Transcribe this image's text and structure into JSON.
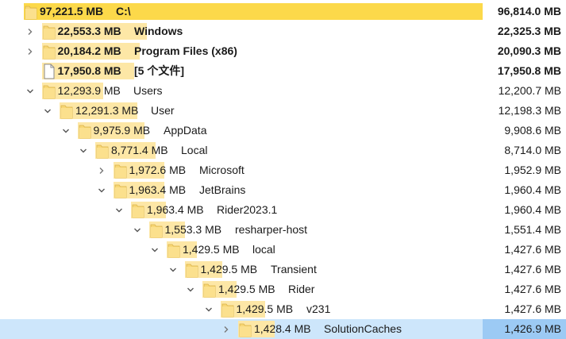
{
  "rows": [
    {
      "size": "97,221.5 MB",
      "name": "C:\\",
      "total": "96,814.0 MB",
      "expanded": null,
      "icon": "folder-icon",
      "bold": true,
      "fraction": 1.0
    },
    {
      "size": "22,553.3 MB",
      "name": "Windows",
      "total": "22,325.3 MB",
      "expanded": false,
      "icon": "folder-icon",
      "bold": true,
      "fraction": 0.232
    },
    {
      "size": "20,184.2 MB",
      "name": "Program Files (x86)",
      "total": "20,090.3 MB",
      "expanded": false,
      "icon": "folder-icon",
      "bold": true,
      "fraction": 0.208
    },
    {
      "size": "17,950.8 MB",
      "name": "[5 个文件]",
      "total": "17,950.8 MB",
      "expanded": null,
      "icon": "file-icon",
      "bold": true,
      "fraction": 0.185
    },
    {
      "size": "12,293.9 MB",
      "name": "Users",
      "total": "12,200.7 MB",
      "expanded": true,
      "icon": "folder-icon",
      "bold": false,
      "fraction": 0.127
    },
    {
      "size": "12,291.3 MB",
      "name": "User",
      "total": "12,198.3 MB",
      "expanded": true,
      "icon": "folder-icon",
      "bold": false,
      "fraction": 0.999
    },
    {
      "size": "9,975.9 MB",
      "name": "AppData",
      "total": "9,908.6 MB",
      "expanded": true,
      "icon": "folder-icon",
      "bold": false,
      "fraction": 0.812
    },
    {
      "size": "8,771.4 MB",
      "name": "Local",
      "total": "8,714.0 MB",
      "expanded": true,
      "icon": "folder-icon",
      "bold": false,
      "fraction": 0.879
    },
    {
      "size": "1,972.6 MB",
      "name": "Microsoft",
      "total": "1,952.9 MB",
      "expanded": false,
      "icon": "folder-icon",
      "bold": false,
      "fraction": 0.225
    },
    {
      "size": "1,963.4 MB",
      "name": "JetBrains",
      "total": "1,960.4 MB",
      "expanded": true,
      "icon": "folder-icon",
      "bold": false,
      "fraction": 0.224
    },
    {
      "size": "1,963.4 MB",
      "name": "Rider2023.1",
      "total": "1,960.4 MB",
      "expanded": true,
      "icon": "folder-icon",
      "bold": false,
      "fraction": 1.0
    },
    {
      "size": "1,553.3 MB",
      "name": "resharper-host",
      "total": "1,551.4 MB",
      "expanded": true,
      "icon": "folder-icon",
      "bold": false,
      "fraction": 0.791
    },
    {
      "size": "1,429.5 MB",
      "name": "local",
      "total": "1,427.6 MB",
      "expanded": true,
      "icon": "folder-icon",
      "bold": false,
      "fraction": 0.92
    },
    {
      "size": "1,429.5 MB",
      "name": "Transient",
      "total": "1,427.6 MB",
      "expanded": true,
      "icon": "folder-icon",
      "bold": false,
      "fraction": 1.0
    },
    {
      "size": "1,429.5 MB",
      "name": "Rider",
      "total": "1,427.6 MB",
      "expanded": true,
      "icon": "folder-icon",
      "bold": false,
      "fraction": 1.0
    },
    {
      "size": "1,429.5 MB",
      "name": "v231",
      "total": "1,427.6 MB",
      "expanded": true,
      "icon": "folder-icon",
      "bold": false,
      "fraction": 1.0
    },
    {
      "size": "1,428.4 MB",
      "name": "SolutionCaches",
      "total": "1,426.9 MB",
      "expanded": false,
      "icon": "folder-icon",
      "bold": false,
      "fraction": 0.999,
      "selected": true
    }
  ]
}
